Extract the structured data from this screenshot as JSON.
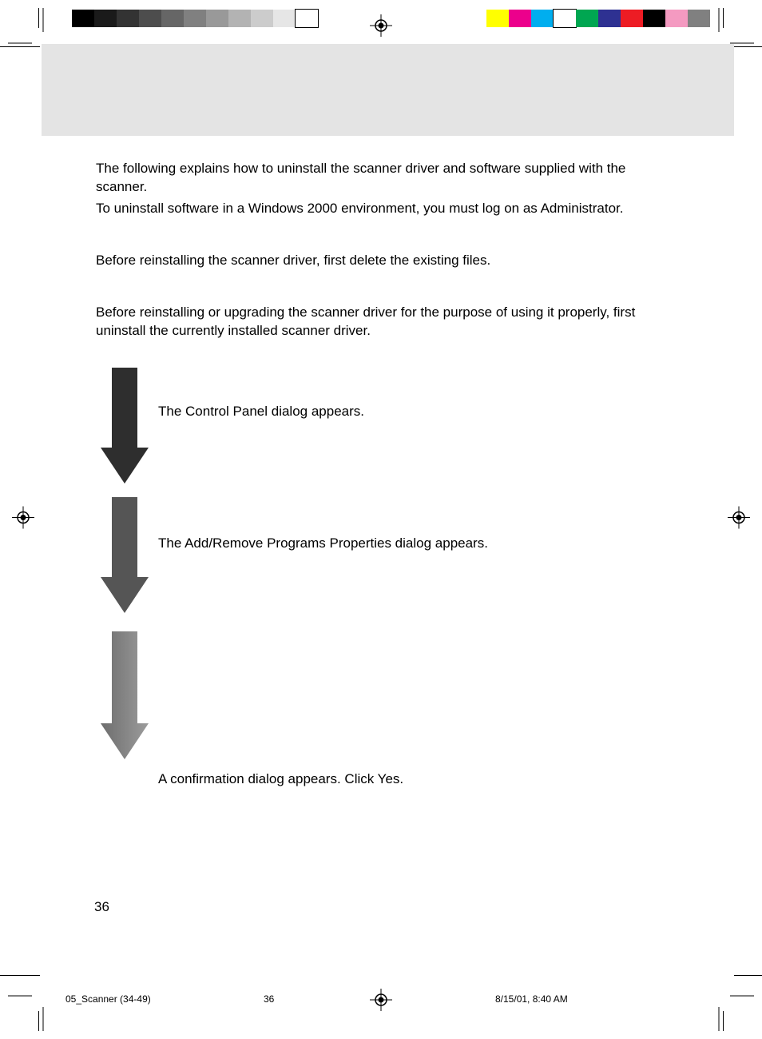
{
  "intro": {
    "p1": "The following explains how to uninstall the scanner driver and software supplied with the scanner.",
    "p2": "To uninstall software in a Windows 2000 environment, you must log on as Administrator."
  },
  "section1": "Before reinstalling the scanner driver, first delete the existing files.",
  "section2": "Before reinstalling or upgrading the scanner driver for the purpose of using it properly, first uninstall the currently installed scanner driver.",
  "steps": {
    "s1": "The Control Panel dialog appears.",
    "s2": "The Add/Remove Programs Properties dialog appears.",
    "s3": "A confirmation dialog appears. Click Yes."
  },
  "page_number": "36",
  "footer": {
    "file": "05_Scanner (34-49)",
    "page": "36",
    "timestamp": "8/15/01, 8:40 AM"
  },
  "colorbar_left": [
    "#000000",
    "#1a1a1a",
    "#333333",
    "#4d4d4d",
    "#666666",
    "#808080",
    "#999999",
    "#b3b3b3",
    "#cccccc",
    "#e6e6e6",
    "#ffffff"
  ],
  "colorbar_right": [
    "#ffff00",
    "#ec008c",
    "#00aeef",
    "#ffffff",
    "#00a651",
    "#2e3192",
    "#ed1c24",
    "#000000",
    "#f49ac1",
    "#808080"
  ]
}
